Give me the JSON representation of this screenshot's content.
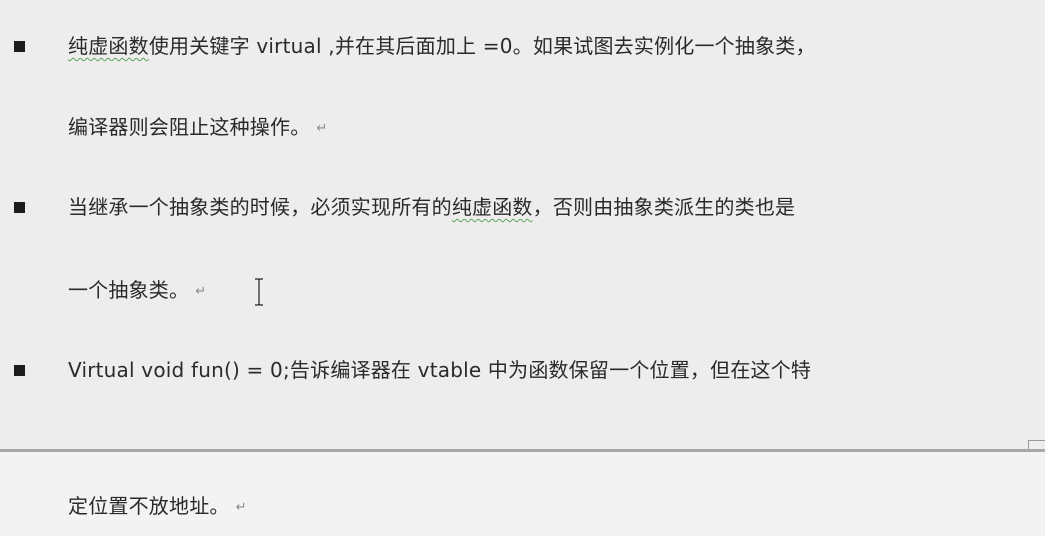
{
  "paragraphs": [
    {
      "line1_a": "纯虚函数",
      "line1_b": "使用关键字 virtual ,并在其后面加上 =0。如果试图去实例化一个抽象类，",
      "line2": "编译器则会阻止这种操作。"
    },
    {
      "line1_a": "当继承一个抽象类的时候，必须实现所有的",
      "line1_b": "纯虚函数",
      "line1_c": "，否则由抽象类派生的类也是",
      "line2": "一个抽象类。"
    },
    {
      "line1": "Virtual void fun() = 0;告诉编译器在 vtable 中为函数保留一个位置，但在这个特",
      "line2": "定位置不放地址。"
    }
  ],
  "paragraph_mark": "↵",
  "colors": {
    "background": "#ededed",
    "text": "#2a2a2a",
    "spell_squiggle": "#58a558",
    "page_break": "#a8a8a8"
  },
  "icons": {
    "bullet": "black-square-bullet",
    "paragraph_mark": "return-arrow",
    "cursor": "i-beam-text-cursor"
  }
}
